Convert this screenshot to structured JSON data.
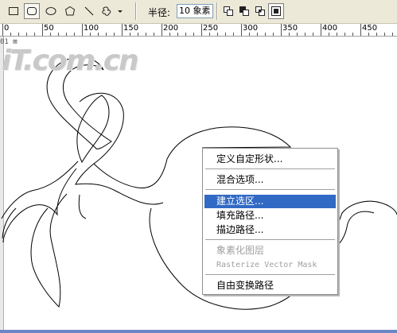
{
  "toolbar": {
    "tools": [
      {
        "name": "rectangle-tool-icon",
        "pressed": false
      },
      {
        "name": "rounded-rectangle-tool-icon",
        "pressed": true
      },
      {
        "name": "ellipse-tool-icon",
        "pressed": false
      },
      {
        "name": "polygon-tool-icon",
        "pressed": false
      },
      {
        "name": "line-tool-icon",
        "pressed": false
      },
      {
        "name": "custom-shape-tool-icon",
        "pressed": false
      }
    ],
    "radius_label": "半径:",
    "radius_value": "10 象素",
    "combine_modes": [
      "add-to-shape-icon",
      "subtract-shape-icon",
      "intersect-shape-icon",
      "exclude-shape-icon"
    ],
    "accent_color": "#316ac5"
  },
  "ruler": {
    "labels": [
      "0",
      "50",
      "100",
      "150",
      "200",
      "250",
      "300",
      "350",
      "400",
      "450"
    ]
  },
  "document": {
    "marker": "01 ⊠"
  },
  "watermark": "iT.com.cn",
  "context_menu": {
    "items": [
      {
        "label": "定义自定形状...",
        "state": "normal"
      },
      {
        "label": "混合选项...",
        "state": "normal"
      },
      {
        "label": "建立选区...",
        "state": "selected"
      },
      {
        "label": "填充路径...",
        "state": "normal"
      },
      {
        "label": "描边路径...",
        "state": "normal"
      },
      {
        "label": "象素化图层",
        "state": "disabled"
      },
      {
        "label": "Rasterize Vector Mask",
        "state": "disabled"
      },
      {
        "label": "自由变换路径",
        "state": "normal"
      }
    ],
    "selected_color": "#316ac5"
  }
}
